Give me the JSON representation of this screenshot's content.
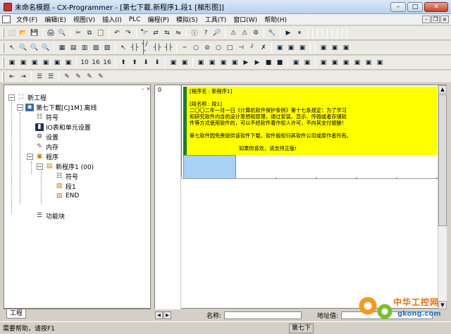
{
  "window": {
    "title": "未命名模题 - CX-Programmer - [第七下載.新程序1.段1 [梯形图]]"
  },
  "menu": [
    "文件(F)",
    "编辑(E)",
    "视图(V)",
    "插入(I)",
    "PLC",
    "编程(P)",
    "模拟(S)",
    "工具(T)",
    "窗口(W)",
    "帮助(H)"
  ],
  "toolbar1": [
    "⬜",
    "📂",
    "💾",
    "",
    "🖨",
    "🔍",
    "",
    "✂",
    "⧉",
    "📋",
    "",
    "↶",
    "↷",
    "",
    "🔭",
    "⇄",
    "⇆",
    "⇋",
    "",
    "ⓘ",
    "?",
    "🔎",
    "",
    "⚠",
    "⚠",
    "⚙",
    "",
    "🔧",
    "",
    "▶",
    "⏸",
    "",
    "",
    "",
    "",
    "",
    "",
    "",
    "",
    ""
  ],
  "toolbar2": [
    "↖",
    "🔍",
    "🔍",
    "🔍",
    "",
    "▦",
    "▤",
    "▥",
    "▧",
    "▨",
    "",
    "↖",
    "┤├",
    "┤/├",
    "┤├",
    "┤├",
    "",
    "─",
    "○",
    "⊘",
    "○",
    "□",
    "⊣",
    "┘",
    "✗",
    "",
    "▣",
    "▣",
    "▣",
    "",
    "",
    "▣",
    "▣",
    "▣"
  ],
  "toolbar3": [
    "▣",
    "▣",
    "▣",
    "▣",
    "▣",
    "▣",
    "",
    "10",
    "16",
    "16",
    "",
    "⬆",
    "⬆",
    "⬇",
    "⬇",
    "",
    "▣",
    "▣",
    "",
    "▣",
    "▣",
    "▣",
    "▣",
    "▶",
    "▶",
    "■",
    "■",
    "",
    "▣",
    "▣",
    "",
    "▣",
    "▣",
    "▣",
    "▣",
    "▣",
    "▣"
  ],
  "toolbar4": [
    "⇤",
    "⇥",
    "",
    "☰",
    "☰",
    "",
    "✎",
    "✎",
    "✎",
    "✎"
  ],
  "tree": {
    "root": "新工程",
    "plc": "第七下載[CJ1M] 离线",
    "symbols": "符号",
    "io": "IO表和单元设置",
    "settings": "设置",
    "memory": "内存",
    "programs": "程序",
    "newprog": "新程序1 (00)",
    "psymbols": "符号",
    "section": "段1",
    "end": "END",
    "funcblocks": "功能块"
  },
  "tab": "工程",
  "rung": {
    "number": "0"
  },
  "comment": {
    "lines": [
      "[程序名 : 新程序1]",
      "",
      "[段名称 : 段1]",
      "二〇〇二年一月一日《计算机软件保护条例》第十七条规定：为了学习",
      "和研究软件内含的设计思想和原理，通过安装、显示、传输或者存储软",
      "件等方式使用软件的，可以不经软件著作权人许可，不向其支付报酬！",
      "",
      "第七软件园免费提供该软件下载，软件版权归其软件公司或原作者所有。",
      "",
      "如果你喜欢，请支持正版!"
    ]
  },
  "hbar": {
    "name_label": "名称:",
    "addr_label": "地址值:"
  },
  "status": {
    "help": "需要帮助，请按F1",
    "plc": "第七下"
  },
  "watermark": {
    "cn": "中华工控网",
    "url": "gkong.com"
  },
  "colors": {
    "comment_bg": "#ffff00",
    "comment_border": "#1b7d2a",
    "cursor": "#a9d0f5"
  }
}
